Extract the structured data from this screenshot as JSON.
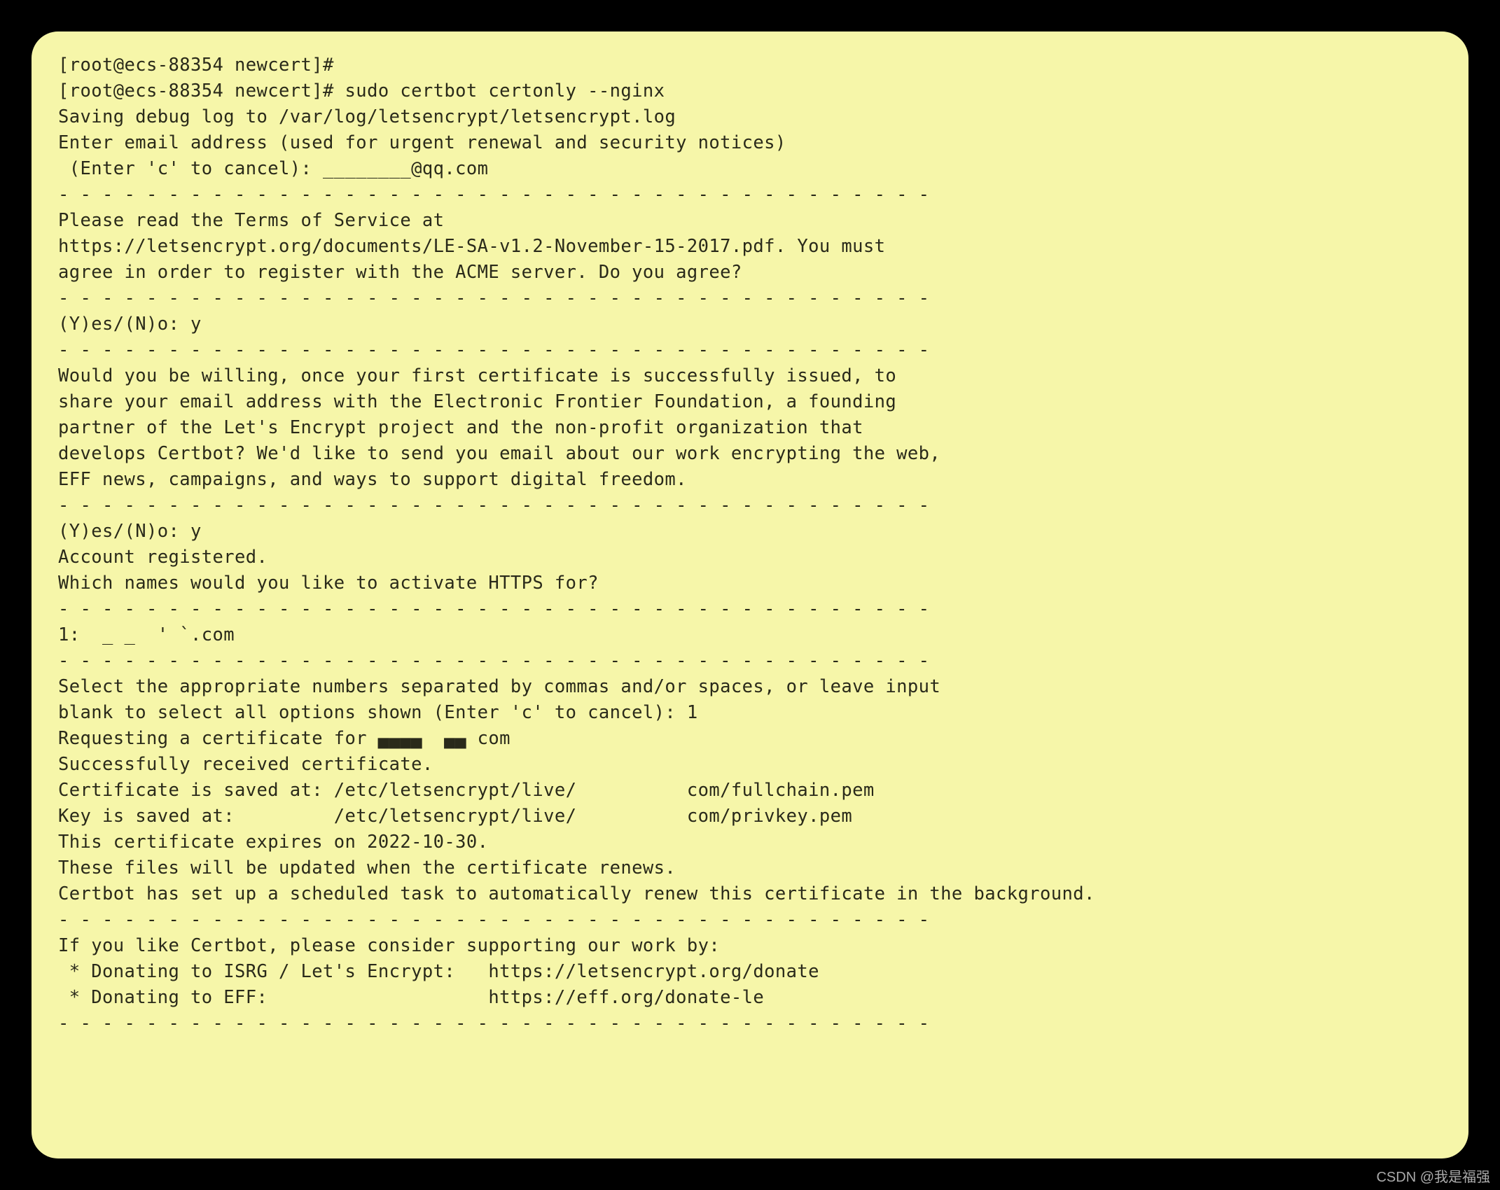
{
  "terminal": {
    "lines": [
      "[root@ecs-88354 newcert]#",
      "[root@ecs-88354 newcert]# sudo certbot certonly --nginx",
      "Saving debug log to /var/log/letsencrypt/letsencrypt.log",
      "Enter email address (used for urgent renewal and security notices)",
      " (Enter 'c' to cancel): ________@qq.com",
      "",
      "- - - - - - - - - - - - - - - - - - - - - - - - - - - - - - - - - - - - - - - -",
      "Please read the Terms of Service at",
      "https://letsencrypt.org/documents/LE-SA-v1.2-November-15-2017.pdf. You must",
      "agree in order to register with the ACME server. Do you agree?",
      "- - - - - - - - - - - - - - - - - - - - - - - - - - - - - - - - - - - - - - - -",
      "(Y)es/(N)o: y",
      "",
      "- - - - - - - - - - - - - - - - - - - - - - - - - - - - - - - - - - - - - - - -",
      "Would you be willing, once your first certificate is successfully issued, to",
      "share your email address with the Electronic Frontier Foundation, a founding",
      "partner of the Let's Encrypt project and the non-profit organization that",
      "develops Certbot? We'd like to send you email about our work encrypting the web,",
      "EFF news, campaigns, and ways to support digital freedom.",
      "- - - - - - - - - - - - - - - - - - - - - - - - - - - - - - - - - - - - - - - -",
      "(Y)es/(N)o: y",
      "Account registered.",
      "",
      "Which names would you like to activate HTTPS for?",
      "- - - - - - - - - - - - - - - - - - - - - - - - - - - - - - - - - - - - - - - -",
      "1:  _ _  ' `.com",
      "- - - - - - - - - - - - - - - - - - - - - - - - - - - - - - - - - - - - - - - -",
      "Select the appropriate numbers separated by commas and/or spaces, or leave input",
      "blank to select all options shown (Enter 'c' to cancel): 1",
      "Requesting a certificate for ▄▄▄▄  ▄▄ com",
      "",
      "Successfully received certificate.",
      "Certificate is saved at: /etc/letsencrypt/live/          com/fullchain.pem",
      "Key is saved at:         /etc/letsencrypt/live/          com/privkey.pem",
      "This certificate expires on 2022-10-30.",
      "These files will be updated when the certificate renews.",
      "Certbot has set up a scheduled task to automatically renew this certificate in the background.",
      "",
      "- - - - - - - - - - - - - - - - - - - - - - - - - - - - - - - - - - - - - - - -",
      "If you like Certbot, please consider supporting our work by:",
      " * Donating to ISRG / Let's Encrypt:   https://letsencrypt.org/donate",
      " * Donating to EFF:                    https://eff.org/donate-le",
      "- - - - - - - - - - - - - - - - - - - - - - - - - - - - - - - - - - - - - - - -"
    ]
  },
  "watermark": "CSDN @我是福强"
}
